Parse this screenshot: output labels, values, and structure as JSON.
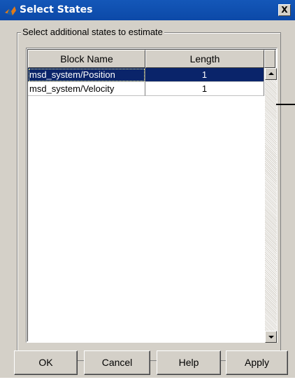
{
  "window": {
    "title": "Select States",
    "close_glyph": "X",
    "app_icon": "matlab-icon"
  },
  "group": {
    "label": "Select additional states to estimate"
  },
  "table": {
    "columns": [
      "Block Name",
      "Length"
    ],
    "rows": [
      {
        "name": "msd_system/Position",
        "length": "1",
        "selected": true
      },
      {
        "name": "msd_system/Velocity",
        "length": "1",
        "selected": false
      }
    ]
  },
  "buttons": {
    "ok": "OK",
    "cancel": "Cancel",
    "help": "Help",
    "apply": "Apply"
  },
  "colors": {
    "title_bar": "#0c49a8",
    "selection": "#0a246a",
    "face": "#d4d0c8"
  }
}
